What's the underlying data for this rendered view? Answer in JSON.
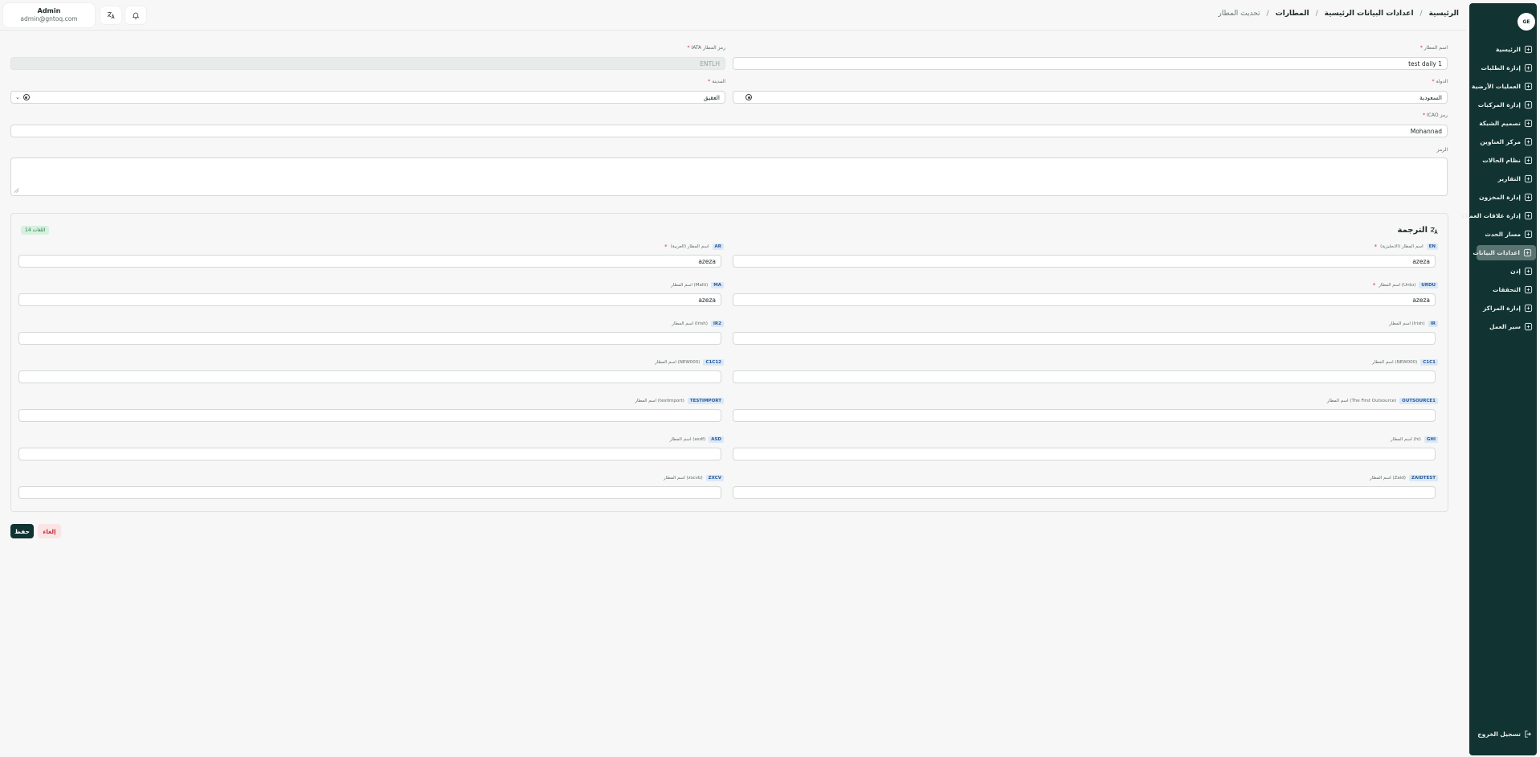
{
  "user": {
    "name": "Admin",
    "email": "admin@gntoq.com"
  },
  "breadcrumb": {
    "home": "الرئيسية",
    "master": "اعدادات البيانات الرئيسية",
    "airports": "المطارات",
    "current": "تحديث المطار",
    "sep": "/"
  },
  "sidebar": {
    "logo": "GE",
    "items": [
      {
        "label": "الرئيسية",
        "icon": "dashboard-icon"
      },
      {
        "label": "إدارة الطلبات",
        "icon": "orders-icon"
      },
      {
        "label": "العمليات الأرضية",
        "icon": "ground-ops-icon"
      },
      {
        "label": "إدارة المركبات",
        "icon": "truck-icon"
      },
      {
        "label": "تصميم الشبكة",
        "icon": "network-icon"
      },
      {
        "label": "مركز العناوين",
        "icon": "address-icon"
      },
      {
        "label": "نظام الحالات",
        "icon": "status-icon"
      },
      {
        "label": "التقارير",
        "icon": "reports-icon"
      },
      {
        "label": "إدارة المخزون",
        "icon": "inventory-icon"
      },
      {
        "label": "إدارة علاقات العملاء",
        "icon": "crm-icon"
      },
      {
        "label": "مسار الحدث",
        "icon": "route-icon"
      },
      {
        "label": "اعدادات البيانات",
        "icon": "database-icon"
      },
      {
        "label": "إذن",
        "icon": "users-icon"
      },
      {
        "label": "التحققات",
        "icon": "validation-icon"
      },
      {
        "label": "إدارة المراكز",
        "icon": "centers-icon"
      },
      {
        "label": "سير العمل",
        "icon": "workflow-icon"
      }
    ],
    "logout": "تسجيل الخروج"
  },
  "form": {
    "airport_name": {
      "label": "اسم المطار",
      "value": "test daily 1"
    },
    "iata": {
      "label": "رمز المطار IATA",
      "value": "ENTLH"
    },
    "country": {
      "label": "الدولة",
      "value": "السعودية"
    },
    "city": {
      "label": "المدينة",
      "value": "العقيق"
    },
    "icao": {
      "label": "رمز ICAO",
      "value": "Mohannad"
    },
    "notes": {
      "label": "الرمز",
      "value": ""
    }
  },
  "translations": {
    "title": "الترجمة",
    "count": "14 اللغات",
    "rows": [
      {
        "right": {
          "code": "EN",
          "label": "اسم المطار (الانجليزية)",
          "required": true,
          "value": "azeza"
        },
        "left": {
          "code": "AR",
          "label": "اسم المطار (العربية)",
          "required": true,
          "value": "azeza"
        }
      },
      {
        "right": {
          "code": "URDU",
          "label": "اسم المطار (Urdu)",
          "required": true,
          "value": "azeza"
        },
        "left": {
          "code": "MA",
          "label": "اسم المطار (Malti)",
          "required": false,
          "value": "azeza"
        }
      },
      {
        "right": {
          "code": "IR",
          "label": "اسم المطار (Irish)",
          "required": false,
          "value": ""
        },
        "left": {
          "code": "IR2",
          "label": "اسم المطار (Irish)",
          "required": false,
          "value": ""
        }
      },
      {
        "right": {
          "code": "C1C1",
          "label": "اسم المطار (NEW000)",
          "required": false,
          "value": ""
        },
        "left": {
          "code": "C1C12",
          "label": "اسم المطار (NEW000)",
          "required": false,
          "value": ""
        }
      },
      {
        "right": {
          "code": "OUTSOURCE1",
          "label": "اسم المطار (The First Outsource)",
          "required": false,
          "value": ""
        },
        "left": {
          "code": "TESTIMPORT",
          "label": "اسم المطار (testimport)",
          "required": false,
          "value": ""
        }
      },
      {
        "right": {
          "code": "GHI",
          "label": "اسم المطار (hi)",
          "required": false,
          "value": ""
        },
        "left": {
          "code": "ASD",
          "label": "اسم المطار (asdf)",
          "required": false,
          "value": ""
        }
      },
      {
        "right": {
          "code": "ZAIDTEST",
          "label": "اسم المطار (Zaid)",
          "required": false,
          "value": ""
        },
        "left": {
          "code": "ZXCV",
          "label": "اسم المطار (zxcvb)",
          "required": false,
          "value": ""
        }
      }
    ]
  },
  "actions": {
    "save": "حفظ",
    "cancel": "إلغاء"
  }
}
